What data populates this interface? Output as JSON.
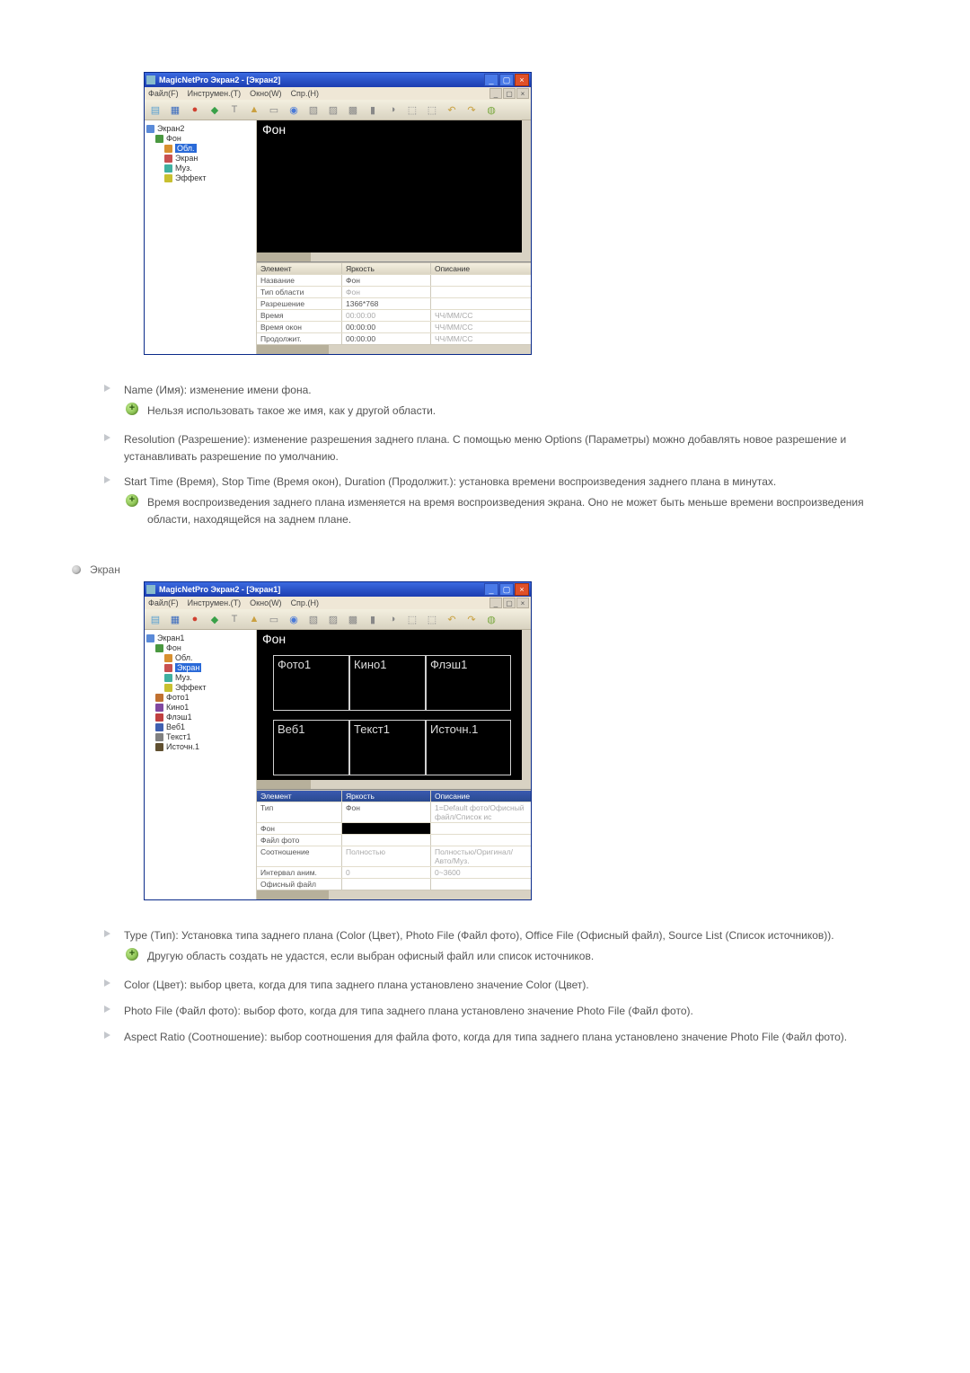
{
  "app": {
    "title1": "MagicNetPro Экран2 - [Экран2]",
    "title2": "MagicNetPro Экран2 - [Экран1]",
    "menu": {
      "file": "Файл(F)",
      "tools": "Инструмен.(T)",
      "window": "Окно(W)",
      "help": "Спр.(H)"
    }
  },
  "stage1": {
    "label": "Фон",
    "tree": {
      "root": "Экран2",
      "bg": "Фон",
      "bgSel": "Обл.",
      "screen": "Экран",
      "music": "Муз.",
      "effect": "Эффект"
    },
    "grid": {
      "h1": "Элемент",
      "h2": "Яркость",
      "h3": "Описание",
      "r1a": "Название",
      "r1b": "Фон",
      "r2a": "Тип области",
      "r2b": "Фон",
      "r3a": "Разрешение",
      "r3b": "1366*768",
      "r4a": "Время",
      "r4b": "00:00:00",
      "r4c": "ЧЧ/ММ/СС",
      "r5a": "Время окон",
      "r5b": "00:00:00",
      "r5c": "ЧЧ/ММ/СС",
      "r6a": "Продолжит.",
      "r6b": "00:00:00",
      "r6c": "ЧЧ/ММ/СС"
    }
  },
  "stage2": {
    "label": "Фон",
    "regions": {
      "r1": "Фото1",
      "r2": "Кино1",
      "r3": "Флэш1",
      "r4": "Веб1",
      "r5": "Текст1",
      "r6": "Источн.1"
    },
    "tree": {
      "root": "Экран1",
      "bg": "Фон",
      "bgSub": "Обл.",
      "screenSel": "Экран",
      "music": "Муз.",
      "effect": "Эффект",
      "photo": "Фото1",
      "cinema": "Кино1",
      "flash": "Флэш1",
      "web": "Веб1",
      "text": "Текст1",
      "source": "Источн.1"
    },
    "grid": {
      "h1": "Элемент",
      "h2": "Яркость",
      "h3": "Описание",
      "r1a": "Тип",
      "r1b": "Фон",
      "r1c": "1=Default фото/Офисный файл/Список ис",
      "r2a": "Фон",
      "r3a": "Файл фото",
      "r4a": "Соотношение",
      "r4b": "Полностью",
      "r4c": "Полностью/Оригинал/Авто/Муз.",
      "r5a": "Интервал аним.",
      "r5b": "0",
      "r5c": "0~3600",
      "r6a": "Офисный файл"
    }
  },
  "doc1": {
    "i1": "Name (Имя): изменение имени фона.",
    "i1n": "Нельзя использовать такое же имя, как у другой области.",
    "i2": "Resolution (Разрешение): изменение разрешения заднего плана. С помощью меню Options (Параметры) можно добавлять новое разрешение и устанавливать разрешение по умолчанию.",
    "i3": "Start Time (Время), Stop Time (Время окон), Duration (Продолжит.): установка времени воспроизведения заднего плана в минутах.",
    "i3n": "Время воспроизведения заднего плана изменяется на время воспроизведения экрана. Оно не может быть меньше времени воспроизведения области, находящейся на заднем плане."
  },
  "section2": {
    "title": "Экран"
  },
  "doc2": {
    "i1": "Type (Тип): Установка типа заднего плана (Color (Цвет), Photo File (Файл фото), Office File (Офисный файл), Source List (Список источников)).",
    "i1n": "Другую область создать не удастся, если выбран офисный файл или список источников.",
    "i2": "Color (Цвет): выбор цвета, когда для типа заднего плана установлено значение Color (Цвет).",
    "i3": "Photo File (Файл фото): выбор фото, когда для типа заднего плана установлено значение Photo File (Файл фото).",
    "i4": "Aspect Ratio (Соотношение): выбор соотношения для файла фото, когда для типа заднего плана установлено значение Photo File (Файл фото)."
  }
}
